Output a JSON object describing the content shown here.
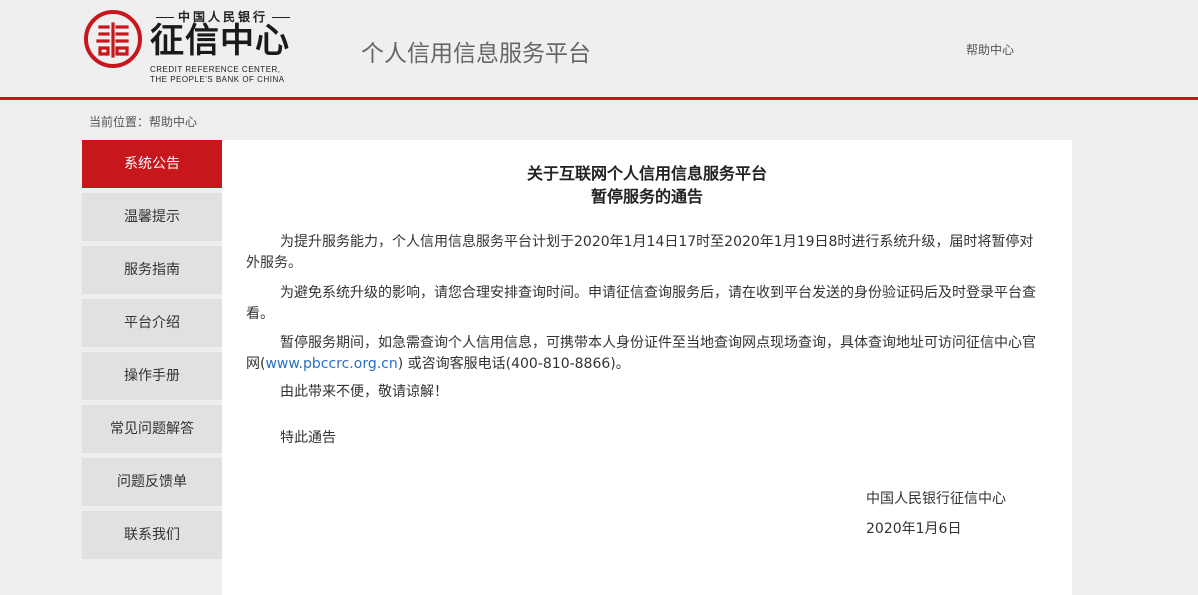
{
  "header": {
    "logo": {
      "top_text": "中国人民银行",
      "main_text": "征信中心",
      "en_line1": "CREDIT REFERENCE CENTER,",
      "en_line2": "THE PEOPLE'S BANK OF CHINA"
    },
    "site_title": "个人信用信息服务平台",
    "help_link": "帮助中心"
  },
  "breadcrumb": "当前位置：帮助中心",
  "sidebar": {
    "items": [
      {
        "label": "系统公告",
        "active": true
      },
      {
        "label": "温馨提示"
      },
      {
        "label": "服务指南"
      },
      {
        "label": "平台介绍"
      },
      {
        "label": "操作手册"
      },
      {
        "label": "常见问题解答"
      },
      {
        "label": "问题反馈单"
      },
      {
        "label": "联系我们"
      }
    ]
  },
  "notice": {
    "title_line1": "关于互联网个人信用信息服务平台",
    "title_line2": "暂停服务的通告",
    "paragraph1": "为提升服务能力，个人信用信息服务平台计划于2020年1月14日17时至2020年1月19日8时进行系统升级，届时将暂停对外服务。",
    "paragraph2": "为避免系统升级的影响，请您合理安排查询时间。申请征信查询服务后，请在收到平台发送的身份验证码后及时登录平台查看。",
    "paragraph3_before": "暂停服务期间，如急需查询个人信用信息，可携带本人身份证件至当地查询网点现场查询，具体查询地址可访问征信中心官网(",
    "paragraph3_link": "www.pbccrc.org.cn",
    "paragraph3_after": ") 或咨询客服电话(400-810-8866)。",
    "paragraph4": "由此带来不便，敬请谅解！",
    "paragraph5": "特此通告",
    "signature_org": "中国人民银行征信中心",
    "signature_date": "2020年1月6日"
  },
  "colors": {
    "accent_red": "#c8161d",
    "link_blue": "#2a6fbf"
  }
}
